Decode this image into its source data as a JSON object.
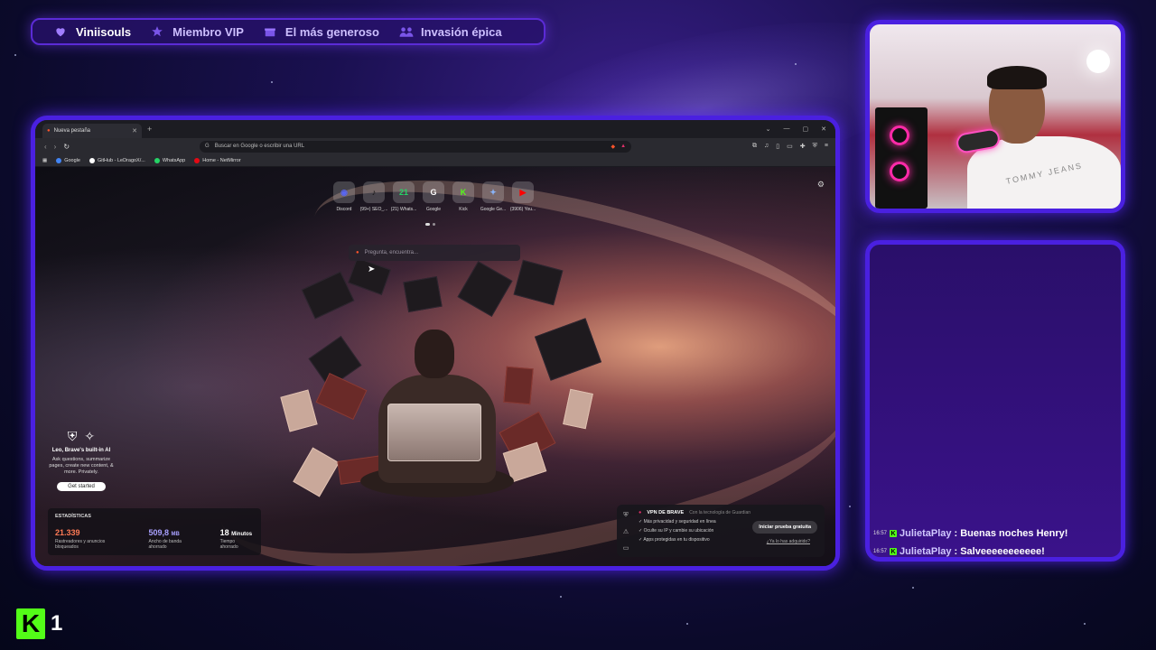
{
  "badges": [
    {
      "icon": "heart-icon",
      "label": "Viniisouls"
    },
    {
      "icon": "star-icon",
      "label": "Miembro VIP"
    },
    {
      "icon": "gift-icon",
      "label": "El más generoso"
    },
    {
      "icon": "group-icon",
      "label": "Invasión épica"
    }
  ],
  "browser": {
    "tab_title": "Nueva pestaña",
    "url_placeholder": "Buscar en Google o escribir una URL",
    "bookmarks": [
      "Google",
      "GitHub - LeDragoX/...",
      "WhatsApp",
      "Home - NetMirror"
    ],
    "speed_dial": [
      {
        "label": "Discord",
        "glyph": "◉",
        "color": "#5865f2"
      },
      {
        "label": "(99+) SEO_...",
        "glyph": "♪",
        "color": "#111111"
      },
      {
        "label": "(21) Whats...",
        "glyph": "21",
        "color": "#25d366"
      },
      {
        "label": "Google",
        "glyph": "G",
        "color": "#ffffff"
      },
      {
        "label": "Kick",
        "glyph": "K",
        "color": "#53fc18"
      },
      {
        "label": "Google Ge...",
        "glyph": "✦",
        "color": "#8ab4f8"
      },
      {
        "label": "(3906) You...",
        "glyph": "▶",
        "color": "#ff0000"
      }
    ],
    "ask_placeholder": "Pregunta, encuentra...",
    "leo": {
      "title": "Leo, Brave's built-in AI",
      "description": "Ask questions, summarize pages, create new content, & more. Privately.",
      "button": "Get started"
    },
    "stats": {
      "title": "ESTADÍSTICAS",
      "items": [
        {
          "value": "21.339",
          "unit": "",
          "label": "Rastreadores y anuncios bloqueados",
          "color": "#ff7a55"
        },
        {
          "value": "509,8",
          "unit": "MB",
          "label": "Ancho de banda ahorrado",
          "color": "#a8a0ff"
        },
        {
          "value": "18",
          "unit": "Minutos",
          "label": "Tiempo ahorrado",
          "color": "#ffffff"
        }
      ]
    },
    "vpn": {
      "title": "VPN DE BRAVE",
      "subtitle": "Con la tecnología de Guardian",
      "features": [
        "Más privacidad y seguridad en línea",
        "Oculte su IP y cambie su ubicación",
        "Apps protegidas en tu dispositivo"
      ],
      "cta": "Iniciar prueba gratuita",
      "link": "¿Ya lo has adquirido?"
    }
  },
  "webcam": {
    "shirt_text": "TOMMY JEANS"
  },
  "chat": {
    "messages": [
      {
        "time": "16:57",
        "user": "JulietaPlay",
        "text": ": Buenas noches Henry!"
      },
      {
        "time": "16:57",
        "user": "JulietaPlay",
        "text": ": Salveeeeeeeeeee!"
      }
    ]
  },
  "footer": {
    "logo_letter": "K",
    "viewers": "1"
  },
  "colors": {
    "frame_border": "#4a20e0",
    "kick_green": "#53fc18"
  }
}
